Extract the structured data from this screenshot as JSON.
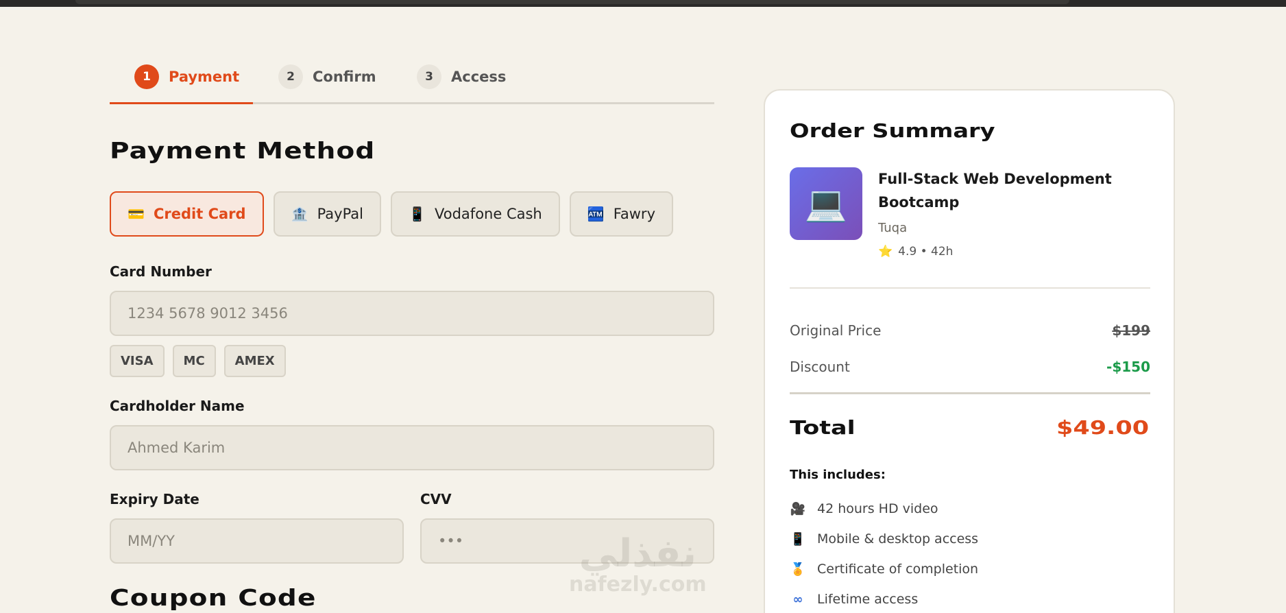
{
  "stepper": {
    "steps": [
      {
        "num": "1",
        "label": "Payment"
      },
      {
        "num": "2",
        "label": "Confirm"
      },
      {
        "num": "3",
        "label": "Access"
      }
    ],
    "active_index": 0
  },
  "payment": {
    "heading": "Payment Method",
    "methods": [
      {
        "label": "Credit Card",
        "icon": "credit-card-icon",
        "glyph": "💳"
      },
      {
        "label": "PayPal",
        "icon": "bank-icon",
        "glyph": "🏦"
      },
      {
        "label": "Vodafone Cash",
        "icon": "mobile-phone-icon",
        "glyph": "📱"
      },
      {
        "label": "Fawry",
        "icon": "atm-icon",
        "glyph": "🏧"
      }
    ],
    "selected_method": "Credit Card",
    "card_number": {
      "label": "Card Number",
      "placeholder": "1234 5678 9012 3456"
    },
    "card_brands": [
      "VISA",
      "MC",
      "AMEX"
    ],
    "cardholder": {
      "label": "Cardholder Name",
      "placeholder": "Ahmed Karim"
    },
    "expiry": {
      "label": "Expiry Date",
      "placeholder": "MM/YY"
    },
    "cvv": {
      "label": "CVV",
      "placeholder": "•••"
    },
    "coupon_heading": "Coupon Code"
  },
  "watermark": {
    "arabic": "نفذلي",
    "latin": "nafezly.com"
  },
  "summary": {
    "title": "Order Summary",
    "course": {
      "thumb_glyph": "💻",
      "title": "Full-Stack Web Development Bootcamp",
      "author": "Tuqa",
      "rating": "4.9",
      "duration": "42h",
      "meta": "4.9 • 42h"
    },
    "original_price_label": "Original Price",
    "original_price": "$199",
    "discount_label": "Discount",
    "discount": "-$150",
    "total_label": "Total",
    "total": "$49.00",
    "includes_heading": "This includes:",
    "includes": [
      {
        "icon": "video-camera-icon",
        "glyph": "🎥",
        "text": "42 hours HD video"
      },
      {
        "icon": "mobile-phone-icon",
        "glyph": "📱",
        "text": "Mobile & desktop access"
      },
      {
        "icon": "medal-icon",
        "glyph": "🏅",
        "text": "Certificate of completion"
      },
      {
        "icon": "infinity-icon",
        "glyph": "∞",
        "text": "Lifetime access"
      }
    ]
  },
  "colors": {
    "accent": "#e04a1a",
    "success": "#1c9b4a",
    "background": "#f5f2ea"
  }
}
